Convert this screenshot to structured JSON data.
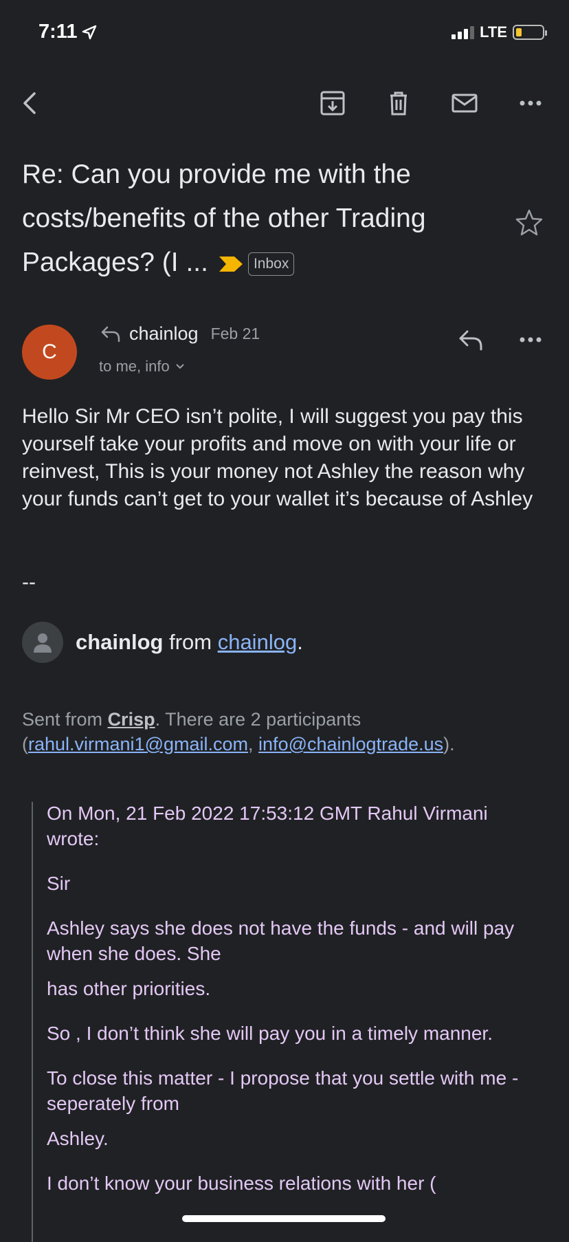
{
  "status_bar": {
    "time": "7:11",
    "network": "LTE"
  },
  "toolbar": {
    "back_icon": "back-arrow-icon",
    "archive_icon": "archive-icon",
    "delete_icon": "trash-icon",
    "mark_unread_icon": "mail-icon",
    "more_icon": "more-horizontal-icon"
  },
  "email": {
    "subject": "Re: Can you provide me with the costs/benefits of the other Trading Packages? (I ...",
    "label": "Inbox",
    "sender": {
      "initial": "C",
      "name": "chainlog",
      "date": "Feb 21",
      "recipients": "to me, info",
      "avatar_color": "#c2491f"
    },
    "body": "Hello Sir Mr CEO isn’t polite, I will suggest you pay this yourself take your profits and move on with your life or reinvest, This is your money not Ashley the reason why your funds can’t get to your wallet it’s because of Ashley",
    "signature_sep": "--",
    "from_line": {
      "name": "chainlog",
      "from": "from",
      "link": "chainlog",
      "end": "."
    },
    "sent_line": {
      "prefix": "Sent from",
      "crisp": "Crisp",
      "middle": ". There are 2 participants",
      "open": "(",
      "email1": "rahul.virmani1@gmail.com",
      "comma": ",",
      "email2": "info@chainlogtrade.us",
      "close": ")."
    },
    "quote": {
      "header": "On Mon, 21 Feb 2022 17:53:12 GMT Rahul Virmani wrote:",
      "p1": "Sir",
      "p2": "Ashley says she does not have the funds - and will pay when she does. She",
      "p3": "has other priorities.",
      "p4": "So , I don’t think she will pay you in a timely manner.",
      "p5": "To close this matter - I propose that you settle with me -seperately from",
      "p6": "Ashley.",
      "p7": "I don’t know your business relations with her ("
    }
  }
}
